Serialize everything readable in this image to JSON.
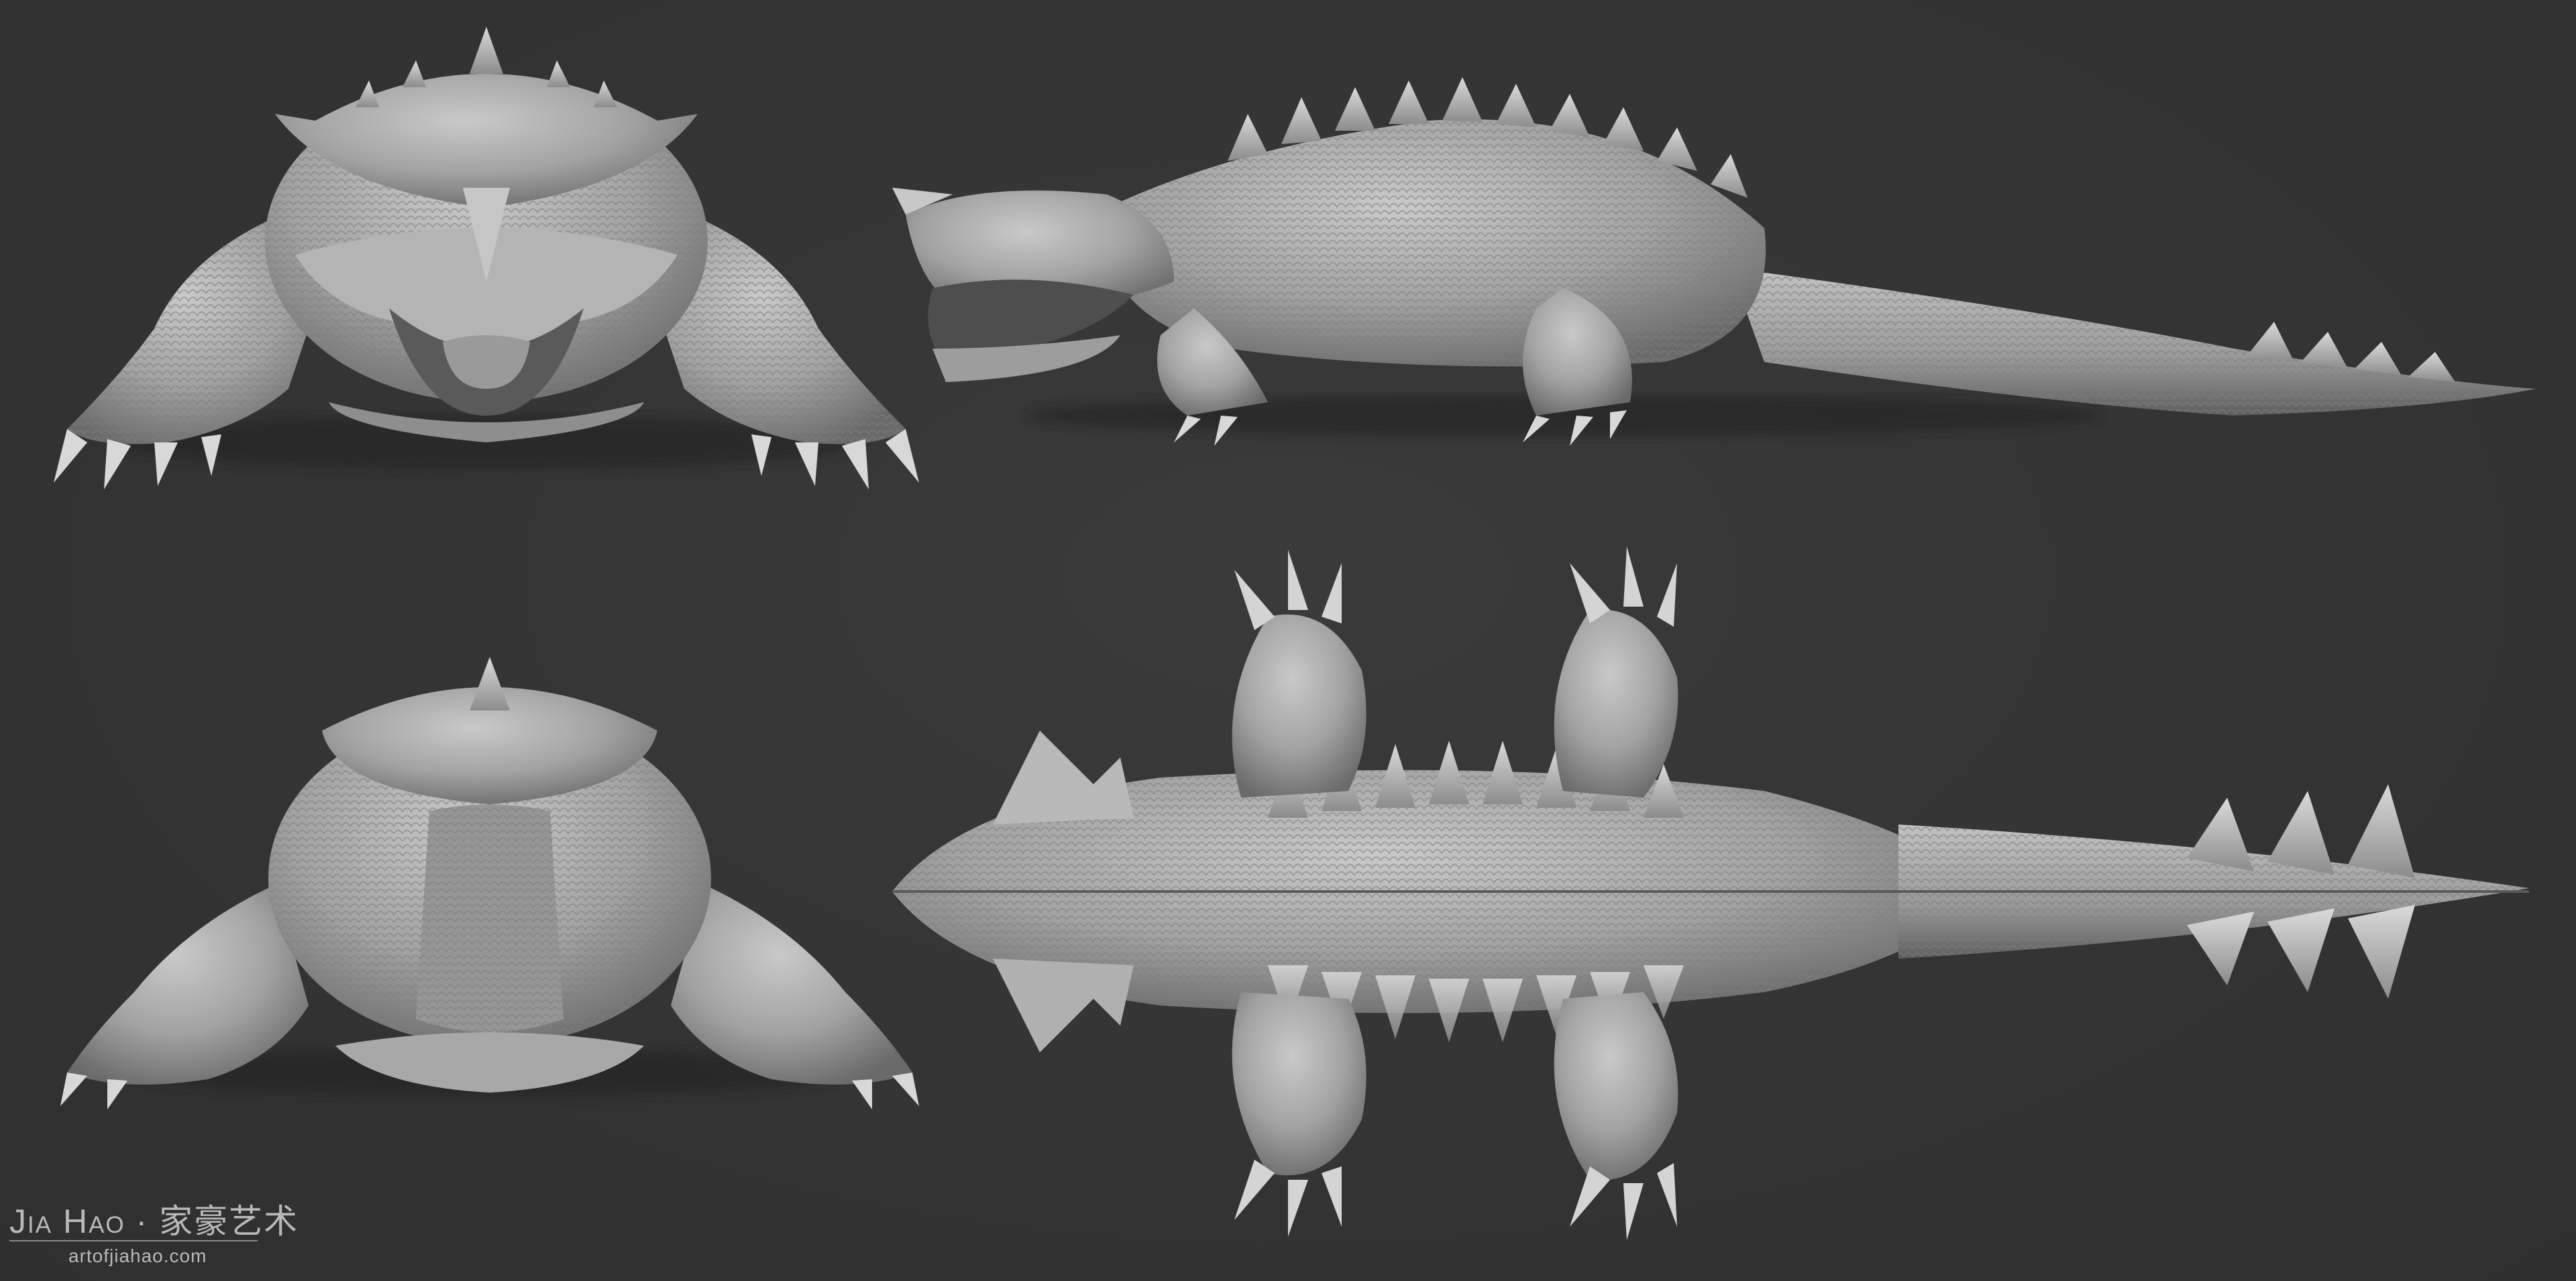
{
  "image": {
    "subject": "sculpted creature model turnaround",
    "background_color": "#353535",
    "model_color": "#a8a8a8",
    "views": [
      {
        "id": "front",
        "label": ""
      },
      {
        "id": "side",
        "label": ""
      },
      {
        "id": "back",
        "label": ""
      },
      {
        "id": "top",
        "label": ""
      }
    ]
  },
  "watermark": {
    "name": "Jia Hao",
    "chinese": "家豪艺术",
    "separator": "·",
    "line1": "Jia Hao · 家豪艺术",
    "url": "artofjiahao.com"
  }
}
